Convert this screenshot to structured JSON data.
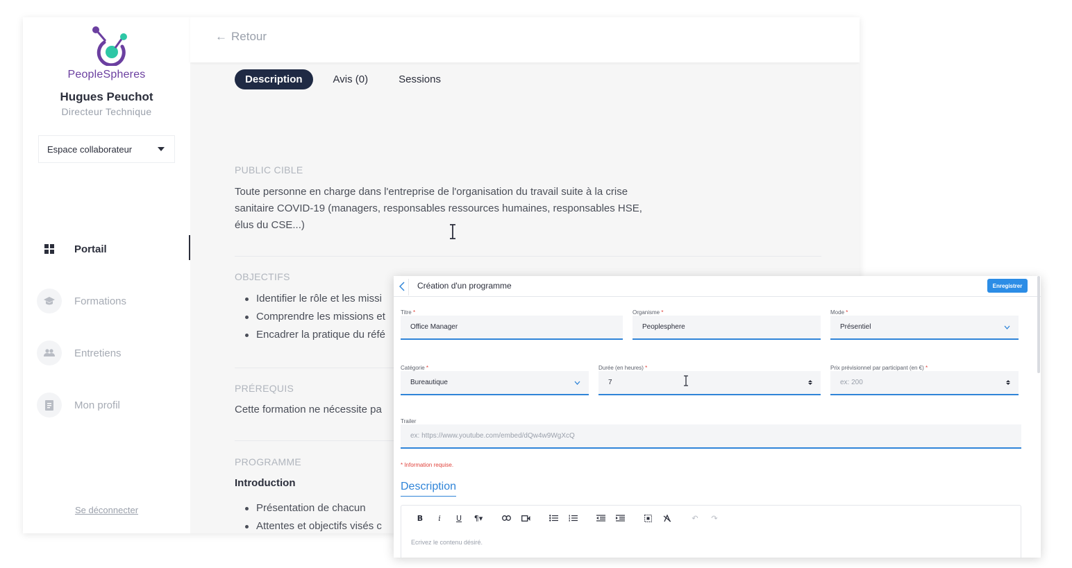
{
  "sidebar": {
    "brand": "PeopleSpheres",
    "user_name": "Hugues Peuchot",
    "user_role": "Directeur Technique",
    "space_select": "Espace collaborateur",
    "items": [
      {
        "label": "Portail",
        "icon": "grid-icon",
        "active": true
      },
      {
        "label": "Formations",
        "icon": "graduation-cap-icon"
      },
      {
        "label": "Entretiens",
        "icon": "users-icon"
      },
      {
        "label": "Mon profil",
        "icon": "document-icon"
      }
    ],
    "logout": "Se déconnecter"
  },
  "topbar": {
    "back": "Retour"
  },
  "tabs": [
    "Description",
    "Avis (0)",
    "Sessions"
  ],
  "content": {
    "public_head": "PUBLIC CIBLE",
    "public_text": [
      "Toute personne en charge dans l'entreprise de l'organisation du travail suite à la crise",
      "sanitaire COVID-19 (managers, responsables ressources humaines, responsables HSE,",
      "élus du CSE...)"
    ],
    "objectifs_head": "OBJECTIFS",
    "objectifs": [
      "Identifier le rôle et les missi",
      "Comprendre les missions et",
      "Encadrer la pratique du réfé"
    ],
    "prerequis_head": "PRÉREQUIS",
    "prerequis_text": "Cette formation ne nécessite pa",
    "programme_head": "PROGRAMME",
    "programme_intro": "Introduction",
    "programme_items": [
      "Présentation de chacun",
      "Attentes et objectifs visés c"
    ]
  },
  "dialog": {
    "title": "Création d'un programme",
    "save": "Enregistrer",
    "fields": {
      "titre": {
        "label": "Titre",
        "value": "Office Manager"
      },
      "organisme": {
        "label": "Organisme",
        "value": "Peoplesphere"
      },
      "mode": {
        "label": "Mode",
        "value": "Présentiel"
      },
      "categorie": {
        "label": "Catégorie",
        "value": "Bureautique"
      },
      "duree": {
        "label": "Durée (en heures)",
        "value": "7"
      },
      "prix": {
        "label": "Prix prévisionnel par participant (en €)",
        "placeholder": "ex: 200"
      },
      "trailer": {
        "label": "Trailer",
        "placeholder": "ex: https://www.youtube.com/embed/dQw4w9WgXcQ"
      }
    },
    "required_note": "* Information requise.",
    "description_heading": "Description",
    "editor_placeholder": "Ecrivez le contenu désiré.",
    "toolbar": [
      "bold-icon",
      "italic-icon",
      "underline-icon",
      "paragraph-icon",
      "link-icon",
      "video-icon",
      "bullet-list-icon",
      "numbered-list-icon",
      "outdent-icon",
      "indent-icon",
      "select-all-icon",
      "clear-format-icon",
      "undo-icon",
      "redo-icon"
    ]
  }
}
